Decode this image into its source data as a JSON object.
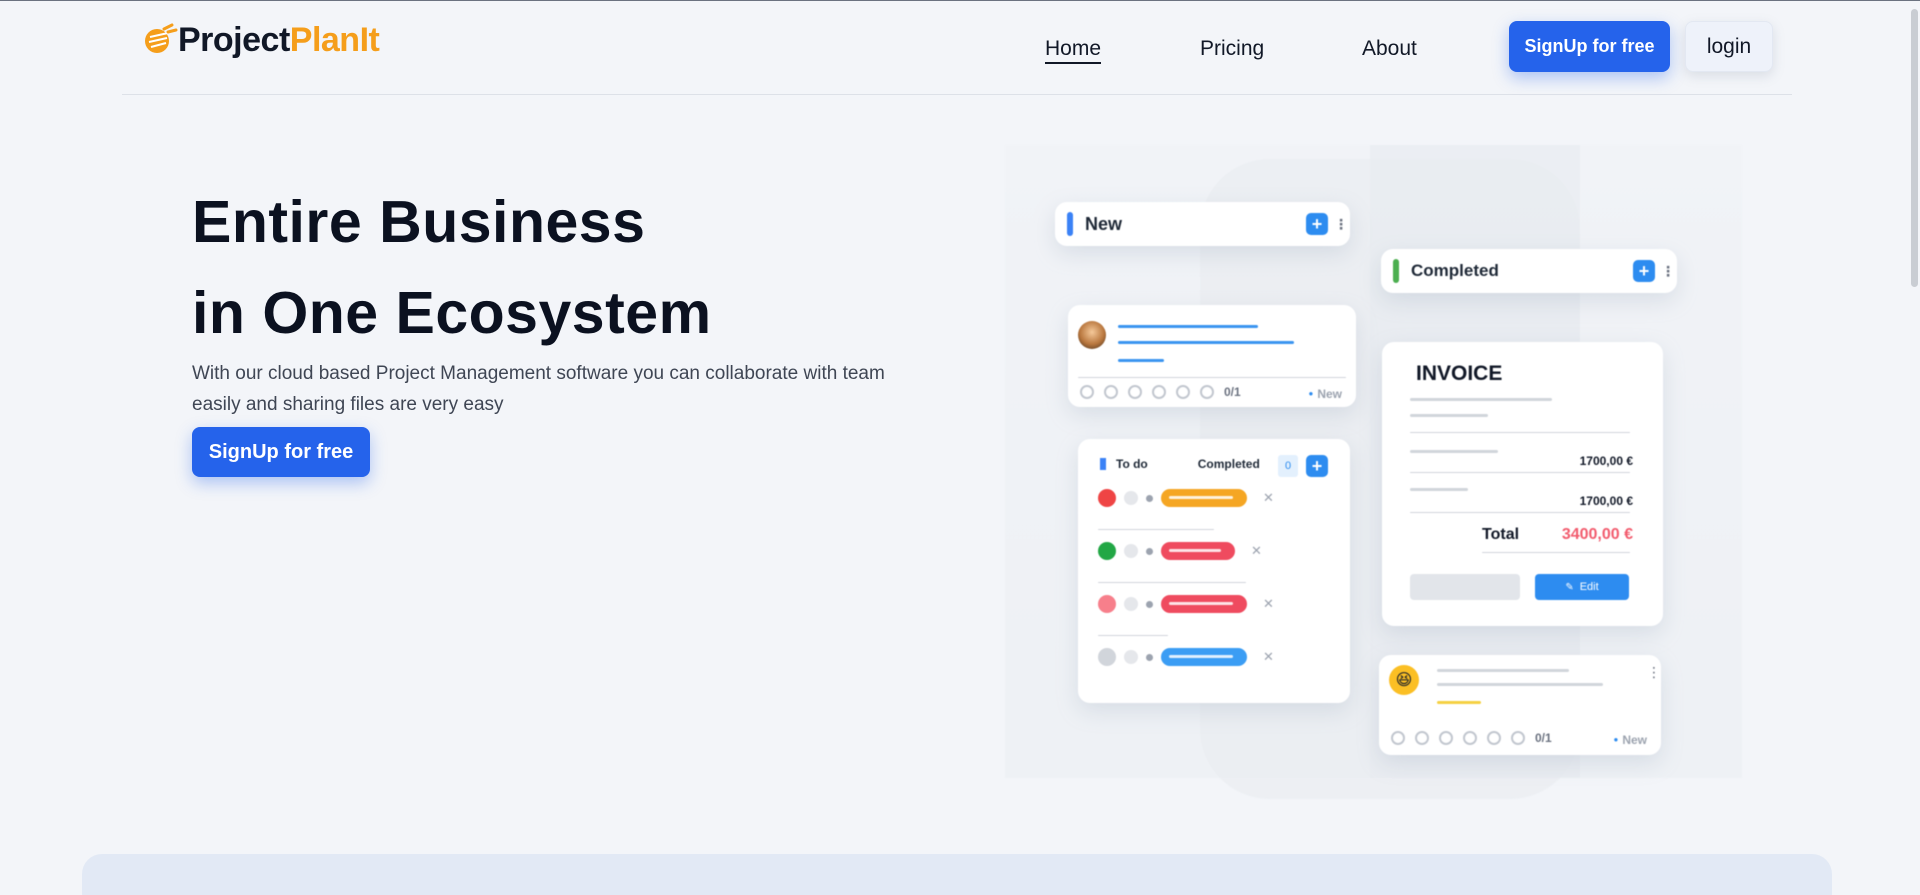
{
  "header": {
    "logo_part1": "Project",
    "logo_part2": "PlanIt",
    "nav": [
      {
        "label": "Home"
      },
      {
        "label": "Pricing"
      },
      {
        "label": "About"
      }
    ],
    "signup_label": "SignUp for free",
    "login_label": "login"
  },
  "hero": {
    "title_line1": "Entire Business",
    "title_line2": "in One Ecosystem",
    "subtitle": "With our cloud based Project Management software you can collaborate with team easily and sharing files are very easy",
    "cta_label": "SignUp for free"
  },
  "illustration": {
    "new_header": "New",
    "completed_header": "Completed",
    "task_meta": "0/1",
    "task_tag": "New",
    "todo_tab": "To do",
    "completed_tab": "Completed",
    "completed_count": "0",
    "invoice": {
      "title": "INVOICE",
      "line1": "1700,00  €",
      "line2": "1700,00  €",
      "total_label": "Total",
      "total_value": "3400,00 €",
      "edit_label": "Edit"
    },
    "note_meta": "0/1",
    "note_tag": "New"
  },
  "colors": {
    "primary": "#2563eb",
    "logo_orange": "#f59e1b",
    "accent_blue": "#2d8cf0",
    "total_red": "#f25c6e"
  }
}
